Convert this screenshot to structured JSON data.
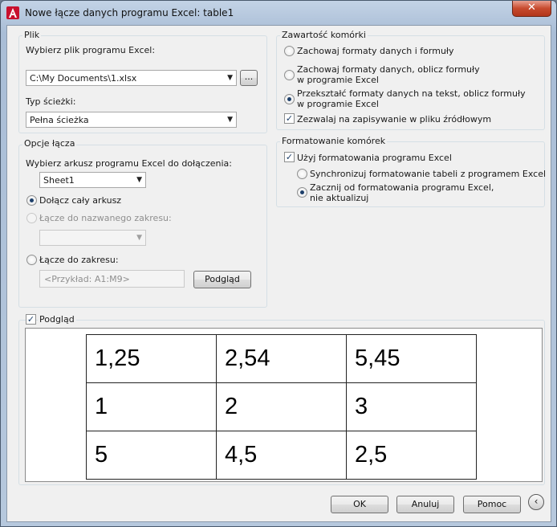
{
  "window": {
    "title": "Nowe łącze danych programu Excel: table1",
    "close_label": "✕"
  },
  "file": {
    "group_label": "Plik",
    "choose_file_label": "Wybierz plik programu Excel:",
    "file_path": "C:\\My Documents\\1.xlsx",
    "browse_label": "...",
    "path_type_label": "Typ ścieżki:",
    "path_type_value": "Pełna ścieżka"
  },
  "link_options": {
    "group_label": "Opcje łącza",
    "choose_sheet_label": "Wybierz arkusz programu Excel do dołączenia:",
    "sheet_value": "Sheet1",
    "link_whole_sheet": "Dołącz cały arkusz",
    "link_named_range": "Łącze do nazwanego zakresu:",
    "named_range_value": "",
    "link_range": "Łącze do zakresu:",
    "range_placeholder": "<Przykład: A1:M9>",
    "preview_button": "Podgląd",
    "selected": "whole_sheet"
  },
  "cell_contents": {
    "group_label": "Zawartość komórki",
    "opt_keep_formats": "Zachowaj formaty danych i formuły",
    "opt_keep_eval_line1": "Zachowaj formaty danych, oblicz formuły",
    "opt_keep_eval_line2": "w programie Excel",
    "opt_convert_line1": "Przekształć formaty danych na tekst, oblicz formuły",
    "opt_convert_line2": "w programie Excel",
    "allow_writeback": "Zezwalaj na zapisywanie w pliku źródłowym",
    "selected": "convert",
    "allow_writeback_checked": true
  },
  "cell_formatting": {
    "group_label": "Formatowanie komórek",
    "use_excel_formatting": "Użyj formatowania programu Excel",
    "use_excel_formatting_checked": true,
    "opt_sync": "Synchronizuj formatowanie tabeli z programem Excel",
    "opt_start_line1": "Zacznij od formatowania programu Excel,",
    "opt_start_line2": "nie aktualizuj",
    "selected": "start"
  },
  "preview": {
    "label": "Podgląd",
    "checked": true,
    "rows": [
      [
        "1,25",
        "2,54",
        "5,45"
      ],
      [
        "1",
        "2",
        "3"
      ],
      [
        "5",
        "4,5",
        "2,5"
      ]
    ]
  },
  "footer": {
    "ok": "OK",
    "cancel": "Anuluj",
    "help": "Pomoc",
    "collapse_icon": "‹"
  },
  "colors": {
    "title_gradient": "#b6c8dd",
    "close_button": "#c74a2e",
    "dialog_bg": "#f0f0f0"
  }
}
